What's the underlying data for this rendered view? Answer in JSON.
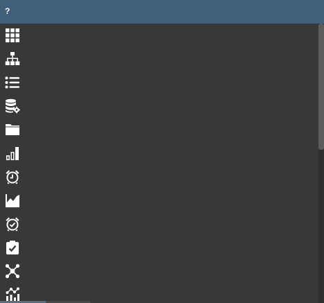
{
  "header": {
    "help_label": "?"
  },
  "colors": {
    "header_bg": "#3f5f7a",
    "panel_bg": "#383838",
    "icon": "#ffffff"
  },
  "sidebar": {
    "items": [
      {
        "icon": "grid-icon"
      },
      {
        "icon": "sitemap-icon"
      },
      {
        "icon": "list-icon"
      },
      {
        "icon": "database-settings-icon"
      },
      {
        "icon": "folder-icon"
      },
      {
        "icon": "bar-chart-icon"
      },
      {
        "icon": "alarm-clock-icon"
      },
      {
        "icon": "area-chart-icon"
      },
      {
        "icon": "alarm-check-icon"
      },
      {
        "icon": "clipboard-check-icon"
      },
      {
        "icon": "network-icon"
      },
      {
        "icon": "chart-nodes-icon"
      }
    ]
  }
}
